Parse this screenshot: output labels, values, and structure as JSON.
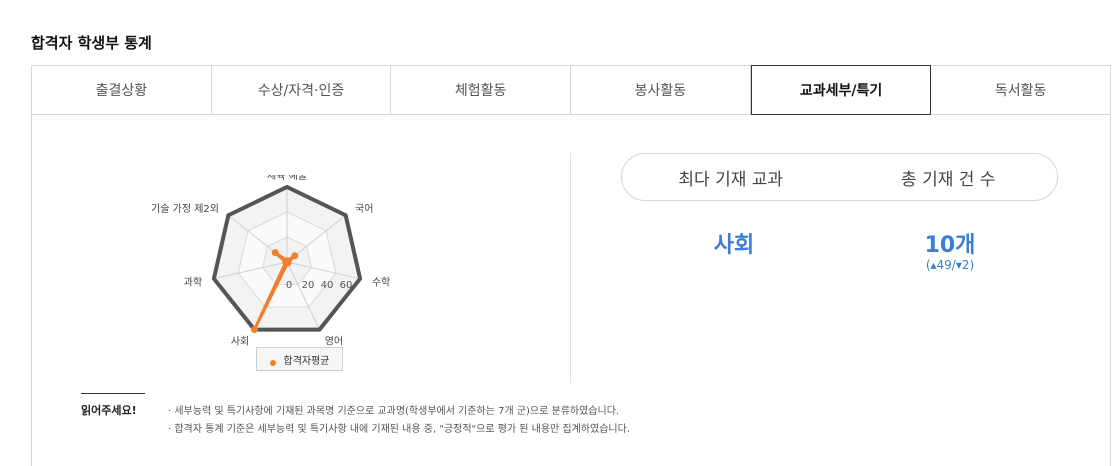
{
  "section_title": "합격자 학생부 통계",
  "tabs": [
    {
      "label": "출결상황"
    },
    {
      "label": "수상/자격·인증"
    },
    {
      "label": "체험활동"
    },
    {
      "label": "봉사활동"
    },
    {
      "label": "교과세부/특기"
    },
    {
      "label": "독서활동"
    }
  ],
  "stats": {
    "most_subject_header": "최다 기재 교과",
    "total_count_header": "총 기재 건 수",
    "most_subject_value": "사회",
    "total_count_value": "10개",
    "total_count_change": "(▴49/▾2)"
  },
  "notice": {
    "label": "읽어주세요!",
    "lines": [
      "· 세부능력 및 특기사항에 기재된 과목명 기준으로 교과명(학생부에서 기준하는 7개 군)으로 분류하였습니다.",
      "· 합격자 통계 기준은 세부능력 및 특기사항 내에 기재된 내용 중, \"긍정적\"으로 평가 된 내용만 집계하였습니다."
    ]
  },
  "chart_data": {
    "type": "radar",
    "categories": [
      "국어",
      "수학",
      "영어",
      "사회",
      "과학",
      "기술 가정 제2외",
      "체육 예술"
    ],
    "tick_labels": [
      "0",
      "20",
      "40",
      "60"
    ],
    "rmax": 60,
    "series": [
      {
        "name": "합격자평균",
        "values": [
          8,
          1,
          1,
          60,
          1,
          12,
          1
        ],
        "color": "#f07f2e"
      }
    ],
    "legend_position": "bottom"
  }
}
